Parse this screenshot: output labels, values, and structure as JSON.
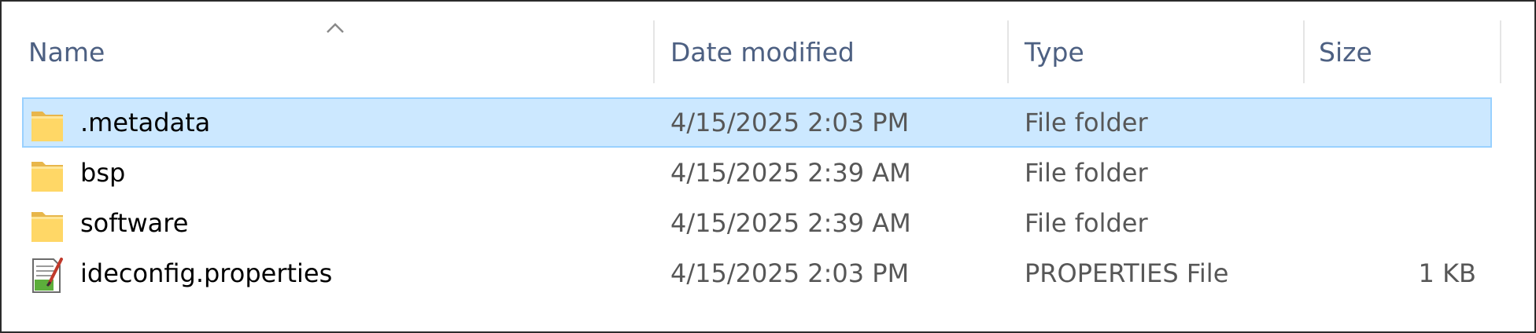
{
  "columns": {
    "name": "Name",
    "date_modified": "Date modified",
    "type": "Type",
    "size": "Size"
  },
  "sort": {
    "column": "name",
    "direction": "ascending",
    "icon": "chevron-up-icon"
  },
  "rows": [
    {
      "name": ".metadata",
      "date": "4/15/2025 2:03 PM",
      "type": "File folder",
      "size": "",
      "icon": "folder-icon",
      "selected": true
    },
    {
      "name": "bsp",
      "date": "4/15/2025 2:39 AM",
      "type": "File folder",
      "size": "",
      "icon": "folder-icon",
      "selected": false
    },
    {
      "name": "software",
      "date": "4/15/2025 2:39 AM",
      "type": "File folder",
      "size": "",
      "icon": "folder-icon",
      "selected": false
    },
    {
      "name": "ideconfig.properties",
      "date": "4/15/2025 2:03 PM",
      "type": "PROPERTIES File",
      "size": "1 KB",
      "icon": "properties-file-icon",
      "selected": false
    }
  ],
  "colors": {
    "header_text": "#4d6082",
    "selection_fill": "#cce8ff",
    "selection_border": "#99d1ff",
    "folder": "#ffd766",
    "secondary_text": "#575757"
  }
}
